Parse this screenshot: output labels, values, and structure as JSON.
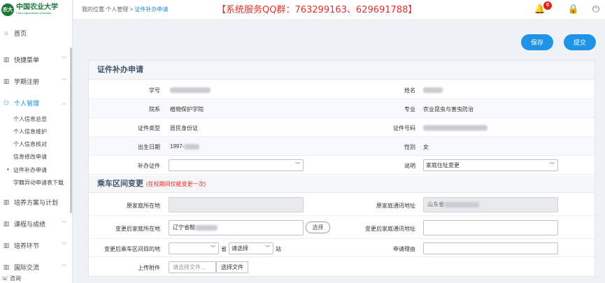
{
  "logo": {
    "emblem": "农大",
    "name_cn": "中国农业大学",
    "name_en": "China Agricultural University"
  },
  "sidebar": {
    "items": [
      {
        "label": "首页",
        "icon": "home-icon"
      },
      {
        "label": "快捷菜单",
        "icon": "bar-chart-icon"
      },
      {
        "label": "学期注册",
        "icon": "bar-chart-icon"
      },
      {
        "label": "个人管理",
        "icon": "user-icon"
      },
      {
        "label": "培养方案与计划",
        "icon": "bar-chart-icon"
      },
      {
        "label": "课程与成绩",
        "icon": "bar-chart-icon"
      },
      {
        "label": "培养环节",
        "icon": "bar-chart-icon"
      },
      {
        "label": "国际交流",
        "icon": "bar-chart-icon"
      }
    ],
    "subitems": [
      "个人信息总览",
      "个人信息维护",
      "个人信息核对",
      "信息修改申请",
      "证件补办申请",
      "学籍异动申请表下载"
    ],
    "bottom": "咨询"
  },
  "header": {
    "breadcrumb_prefix": "我的位置:个人管理 >",
    "breadcrumb_current": "证件补办申请",
    "announcement": "【系统服务QQ群：763299163、629691788】",
    "notification_count": "0"
  },
  "actions": {
    "save": "保存",
    "submit": "提交"
  },
  "form": {
    "section1_title": "证件补办申请",
    "student_id_label": "学号",
    "name_label": "姓名",
    "department_label": "院系",
    "department_value": "植物保护学院",
    "major_label": "专业",
    "major_value": "农业昆虫与害虫防治",
    "id_type_label": "证件类型",
    "id_type_value": "居民身份证",
    "id_number_label": "证件号码",
    "birth_label": "出生日期",
    "birth_value": "1997-",
    "gender_label": "性别",
    "gender_value": "女",
    "reissue_label": "补办证件",
    "reissue_value": "",
    "explain_label": "说明",
    "explain_value": "家庭住址变更",
    "section2_title": "乘车区间变更",
    "section2_note": "(在校期间仅能变更一次)",
    "orig_home_label": "原家庭所在地",
    "orig_addr_label": "原家庭通讯地址",
    "orig_addr_value": "山东省",
    "new_home_label": "变更后家庭所在地",
    "new_home_value": "辽宁省鞍",
    "choose_button": "选择",
    "new_addr_label": "变更后家庭通讯地址",
    "dest_label": "变更后乘车区间目的地",
    "province_unit": "省",
    "station_placeholder": "请选择",
    "station_unit": "站",
    "reason_label": "申请理由",
    "attach_label": "上传附件",
    "file_placeholder": "请选择文件...",
    "file_button": "选择文件"
  }
}
